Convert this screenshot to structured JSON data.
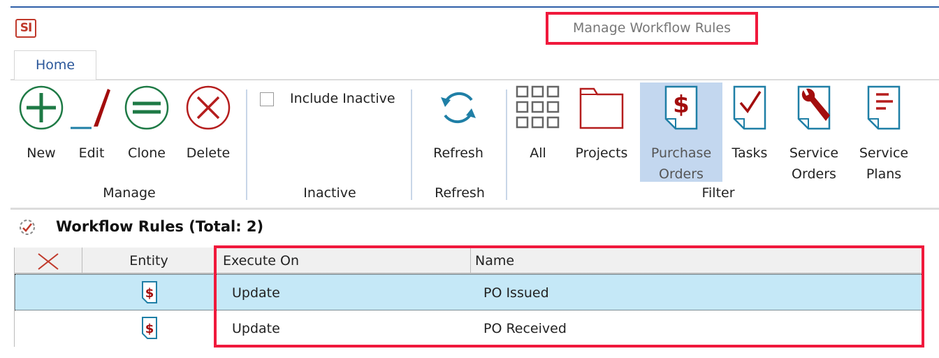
{
  "window": {
    "title": "Manage Workflow Rules",
    "logo_text": "SI"
  },
  "tabs": [
    {
      "label": "Home",
      "active": true
    }
  ],
  "ribbon": {
    "manage": {
      "group_label": "Manage",
      "buttons": [
        {
          "label": "New",
          "icon": "plus-circle-icon"
        },
        {
          "label": "Edit",
          "icon": "pen-icon"
        },
        {
          "label": "Clone",
          "icon": "equals-circle-icon"
        },
        {
          "label": "Delete",
          "icon": "x-circle-icon"
        }
      ]
    },
    "inactive": {
      "group_label": "Inactive",
      "checkbox_label": "Include Inactive",
      "checked": false
    },
    "refresh": {
      "group_label": "Refresh",
      "button_label": "Refresh"
    },
    "filter": {
      "group_label": "Filter",
      "buttons": [
        {
          "label": "All",
          "icon": "grid-icon"
        },
        {
          "label": "Projects",
          "icon": "folder-icon"
        },
        {
          "label": "Purchase Orders",
          "line1": "Purchase",
          "line2": "Orders",
          "icon": "purchase-order-icon",
          "selected": true
        },
        {
          "label": "Tasks",
          "icon": "task-check-icon"
        },
        {
          "label": "Service Orders",
          "line1": "Service",
          "line2": "Orders",
          "icon": "wrench-icon"
        },
        {
          "label": "Service Plans",
          "line1": "Service",
          "line2": "Plans",
          "icon": "document-lines-icon"
        }
      ]
    }
  },
  "section": {
    "title": "Workflow Rules (Total: 2)"
  },
  "grid": {
    "columns": [
      "",
      "Entity",
      "Execute On",
      "Name"
    ],
    "rows": [
      {
        "entity_icon": "purchase-order-icon",
        "execute_on": "Update",
        "name": "PO Issued",
        "selected": true
      },
      {
        "entity_icon": "purchase-order-icon",
        "execute_on": "Update",
        "name": "PO Received",
        "selected": false
      }
    ]
  },
  "colors": {
    "accent": "#2b579a",
    "highlight_box": "#f0193c",
    "selected_row": "#c5e8f7",
    "selected_button": "#c3d7ef"
  }
}
